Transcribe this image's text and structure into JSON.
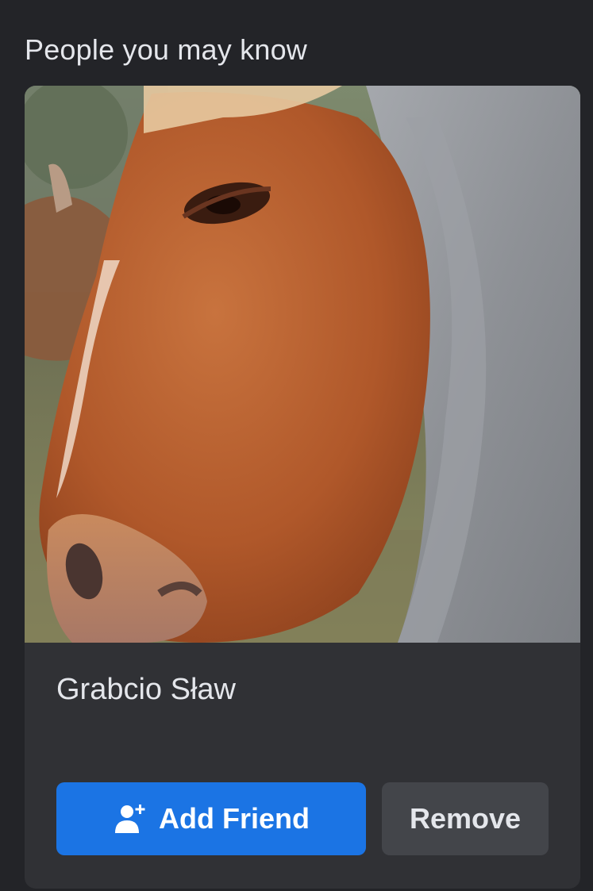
{
  "section": {
    "title": "People you may know"
  },
  "suggestion": {
    "name": "Grabcio Sław",
    "photo_icon": "horse-in-hoodie-photo",
    "add_friend_label": "Add Friend",
    "add_friend_icon": "add-person-icon",
    "remove_label": "Remove"
  },
  "colors": {
    "background": "#232428",
    "card": "#303135",
    "primary_button": "#1b74e4",
    "secondary_button": "#43454a",
    "text": "#e4e6eb"
  }
}
